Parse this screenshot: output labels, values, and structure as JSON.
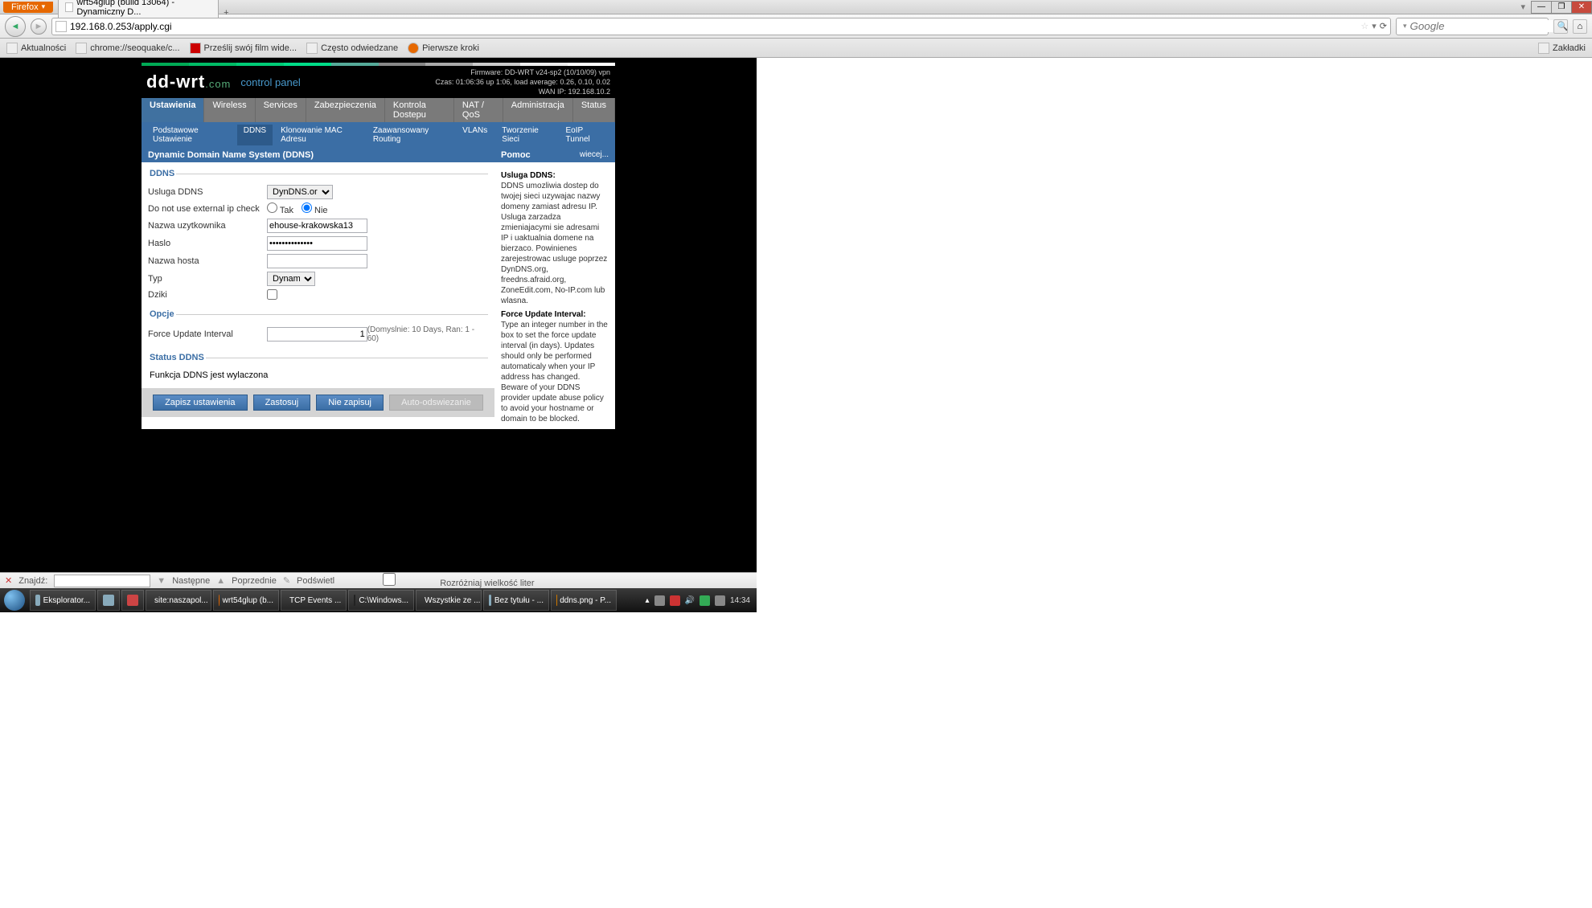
{
  "browser": {
    "menu_btn": "Firefox",
    "tab_title": "wrt54glup (build 13064) - Dynamiczny D...",
    "url": "192.168.0.253/apply.cgi",
    "search_placeholder": "Google",
    "bookmarks": [
      "Aktualności",
      "chrome://seoquake/c...",
      "Prześlij swój film wide...",
      "Często odwiedzane",
      "Pierwsze kroki"
    ],
    "bookmarks_right": "Zakładki"
  },
  "router": {
    "logo_main": "dd-wrt",
    "logo_suffix": ".com",
    "subtitle": "control panel",
    "info": {
      "firmware": "Firmware: DD-WRT v24-sp2 (10/10/09) vpn",
      "czas": "Czas: 01:06:36 up 1:06, load average: 0.26, 0.10, 0.02",
      "wan": "WAN IP: 192.168.10.2"
    },
    "main_tabs": [
      "Ustawienia",
      "Wireless",
      "Services",
      "Zabezpieczenia",
      "Kontrola Dostepu",
      "NAT / QoS",
      "Administracja",
      "Status"
    ],
    "sub_tabs": [
      "Podstawowe Ustawienie",
      "DDNS",
      "Klonowanie MAC Adresu",
      "Zaawansowany Routing",
      "VLANs",
      "Tworzenie Sieci",
      "EoIP Tunnel"
    ],
    "page_title": "Dynamic Domain Name System (DDNS)",
    "sections": {
      "ddns": {
        "legend": "DDNS",
        "service_label": "Usluga DDNS",
        "service_value": "DynDNS.org",
        "ext_ip_label": "Do not use external ip check",
        "ext_ip_yes": "Tak",
        "ext_ip_no": "Nie",
        "user_label": "Nazwa uzytkownika",
        "user_value": "ehouse-krakowska13",
        "pass_label": "Haslo",
        "pass_value": "••••••••••••••",
        "host_label": "Nazwa hosta",
        "host_value": "",
        "type_label": "Typ",
        "type_value": "Dynamiczny",
        "wild_label": "Dziki"
      },
      "opcje": {
        "legend": "Opcje",
        "force_label": "Force Update Interval",
        "force_value": "1",
        "force_hint": "(Domyslnie: 10 Days, Ran: 1 - 60)"
      },
      "status": {
        "legend": "Status DDNS",
        "text": "Funkcja DDNS jest wylaczona"
      }
    },
    "buttons": {
      "save": "Zapisz ustawienia",
      "apply": "Zastosuj",
      "dont_save": "Nie zapisuj",
      "auto": "Auto-odswiezanie"
    },
    "side": {
      "title": "Pomoc",
      "more": "wiecej...",
      "h1": "Usluga DDNS:",
      "p1": "DDNS umozliwia dostep do twojej sieci uzywajac nazwy domeny zamiast adresu IP. Usluga zarzadza zmieniajacymi sie adresami IP i uaktualnia domene na bierzaco. Powinienes zarejestrowac usluge poprzez DynDNS.org, freedns.afraid.org, ZoneEdit.com, No-IP.com lub wlasna.",
      "h2": "Force Update Interval:",
      "p2": "Type an integer number in the box to set the force update interval (in days). Updates should only be performed automaticaly when your IP address has changed. Beware of your DDNS provider update abuse policy to avoid your hostname or domain to be blocked."
    }
  },
  "findbar": {
    "label": "Znajdź:",
    "next": "Następne",
    "prev": "Poprzednie",
    "highlight": "Podświetl",
    "case": "Rozróżniaj wielkość liter"
  },
  "taskbar": {
    "items": [
      "Eksplorator...",
      "",
      "",
      "site:naszapol...",
      "wrt54glup (b...",
      "TCP Events ...",
      "C:\\Windows...",
      "Wszystkie ze ...",
      "Bez tytułu - ...",
      "ddns.png - P..."
    ],
    "clock": "14:34"
  }
}
